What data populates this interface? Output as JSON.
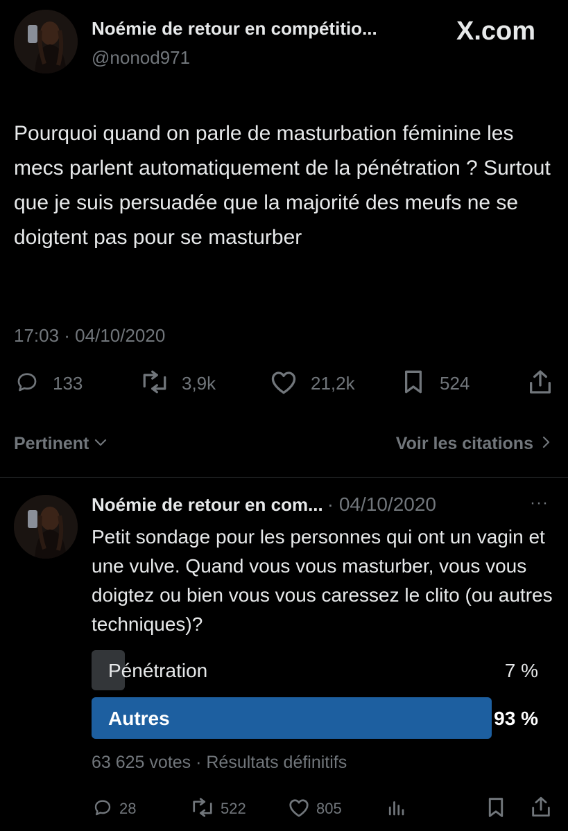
{
  "source_label": "X.com",
  "main_tweet": {
    "author_name": "Noémie de retour en compétitio...",
    "handle": "@nonod971",
    "text": "Pourquoi quand on parle de masturbation féminine les mecs parlent automatiquement de la pénétration ? Surtout que je suis persuadée que la majorité des meufs ne se doigtent pas pour se masturber",
    "timestamp": "17:03 · 04/10/2020",
    "replies": "133",
    "retweets": "3,9k",
    "likes": "21,2k",
    "bookmarks": "524"
  },
  "filters": {
    "sort_label": "Pertinent",
    "quotes_link": "Voir les citations"
  },
  "reply": {
    "author_name": "Noémie de retour en com...",
    "date": "· 04/10/2020",
    "more": "···",
    "text": "Petit sondage pour les personnes qui ont un vagin et une vulve. Quand vous vous masturber, vous vous doigtez ou bien vous vous caressez le clito (ou autres techniques)?",
    "poll": {
      "options": [
        {
          "label": "Pénétration",
          "percent_label": "7 %",
          "percent": 7,
          "winner": false
        },
        {
          "label": "Autres",
          "percent_label": "93 %",
          "percent": 93,
          "winner": true
        }
      ],
      "summary": "63 625 votes · Résultats définitifs",
      "winner_color": "#1d5fa0",
      "other_color": "#333639"
    },
    "replies": "28",
    "retweets": "522",
    "likes": "805"
  }
}
